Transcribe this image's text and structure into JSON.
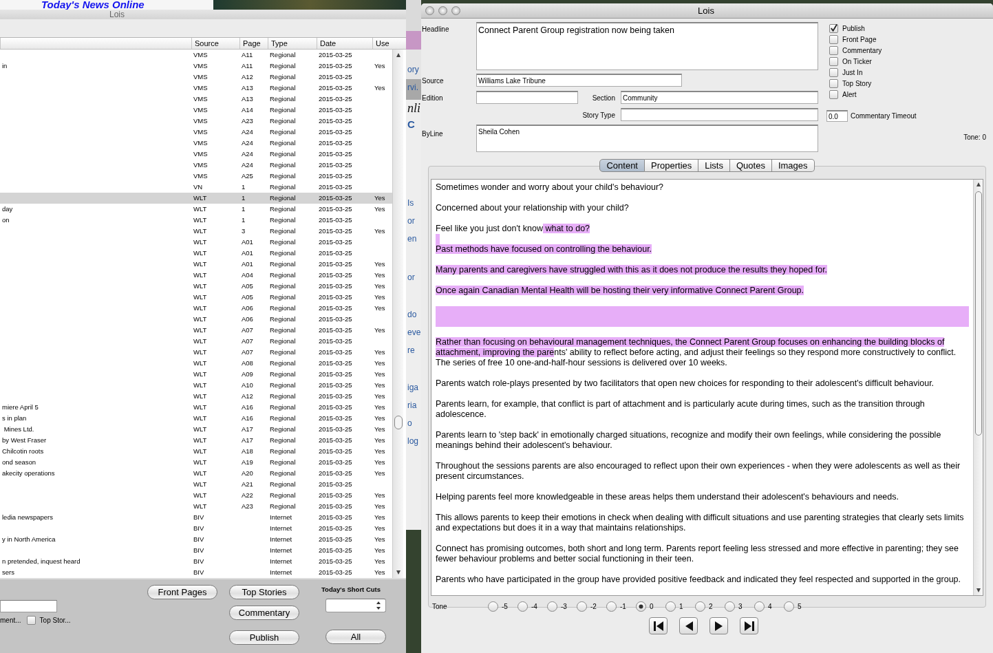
{
  "background": {
    "heading": "Today's News Online",
    "fragments": [
      "ory",
      "rvi.",
      "nli",
      "C",
      "Is",
      "or",
      "en",
      "or",
      "do",
      "eve",
      "re",
      "iga",
      "ria",
      "o",
      "log"
    ]
  },
  "list_window": {
    "title": "Lois",
    "columns": [
      "Source",
      "Page",
      "Type",
      "Date",
      "Use"
    ],
    "rows": [
      {
        "source": "VMS",
        "page": "A11",
        "type": "Regional",
        "date": "2015-03-25",
        "selected": false
      },
      {
        "title": "in",
        "source": "VMS",
        "page": "A11",
        "type": "Regional",
        "date": "2015-03-25",
        "use": "Yes",
        "selected": false
      },
      {
        "source": "VMS",
        "page": "A12",
        "type": "Regional",
        "date": "2015-03-25",
        "selected": false
      },
      {
        "source": "VMS",
        "page": "A13",
        "type": "Regional",
        "date": "2015-03-25",
        "use": "Yes",
        "selected": false
      },
      {
        "source": "VMS",
        "page": "A13",
        "type": "Regional",
        "date": "2015-03-25",
        "selected": false
      },
      {
        "source": "VMS",
        "page": "A14",
        "type": "Regional",
        "date": "2015-03-25",
        "selected": false
      },
      {
        "source": "VMS",
        "page": "A23",
        "type": "Regional",
        "date": "2015-03-25",
        "selected": false
      },
      {
        "source": "VMS",
        "page": "A24",
        "type": "Regional",
        "date": "2015-03-25",
        "selected": false
      },
      {
        "source": "VMS",
        "page": "A24",
        "type": "Regional",
        "date": "2015-03-25",
        "selected": false
      },
      {
        "source": "VMS",
        "page": "A24",
        "type": "Regional",
        "date": "2015-03-25",
        "selected": false
      },
      {
        "source": "VMS",
        "page": "A24",
        "type": "Regional",
        "date": "2015-03-25",
        "selected": false
      },
      {
        "source": "VMS",
        "page": "A25",
        "type": "Regional",
        "date": "2015-03-25",
        "selected": false
      },
      {
        "source": "VN",
        "page": "1",
        "type": "Regional",
        "date": "2015-03-25",
        "selected": false
      },
      {
        "source": "WLT",
        "page": "1",
        "type": "Regional",
        "date": "2015-03-25",
        "use": "Yes",
        "selected": true
      },
      {
        "title": "day",
        "source": "WLT",
        "page": "1",
        "type": "Regional",
        "date": "2015-03-25",
        "use": "Yes",
        "selected": false
      },
      {
        "title": "on",
        "source": "WLT",
        "page": "1",
        "type": "Regional",
        "date": "2015-03-25",
        "selected": false
      },
      {
        "source": "WLT",
        "page": "3",
        "type": "Regional",
        "date": "2015-03-25",
        "use": "Yes",
        "selected": false
      },
      {
        "source": "WLT",
        "page": "A01",
        "type": "Regional",
        "date": "2015-03-25",
        "selected": false
      },
      {
        "source": "WLT",
        "page": "A01",
        "type": "Regional",
        "date": "2015-03-25",
        "selected": false
      },
      {
        "source": "WLT",
        "page": "A01",
        "type": "Regional",
        "date": "2015-03-25",
        "use": "Yes",
        "selected": false
      },
      {
        "source": "WLT",
        "page": "A04",
        "type": "Regional",
        "date": "2015-03-25",
        "use": "Yes",
        "selected": false
      },
      {
        "source": "WLT",
        "page": "A05",
        "type": "Regional",
        "date": "2015-03-25",
        "use": "Yes",
        "selected": false
      },
      {
        "source": "WLT",
        "page": "A05",
        "type": "Regional",
        "date": "2015-03-25",
        "use": "Yes",
        "selected": false
      },
      {
        "source": "WLT",
        "page": "A06",
        "type": "Regional",
        "date": "2015-03-25",
        "use": "Yes",
        "selected": false
      },
      {
        "source": "WLT",
        "page": "A06",
        "type": "Regional",
        "date": "2015-03-25",
        "selected": false
      },
      {
        "source": "WLT",
        "page": "A07",
        "type": "Regional",
        "date": "2015-03-25",
        "use": "Yes",
        "selected": false
      },
      {
        "source": "WLT",
        "page": "A07",
        "type": "Regional",
        "date": "2015-03-25",
        "selected": false
      },
      {
        "source": "WLT",
        "page": "A07",
        "type": "Regional",
        "date": "2015-03-25",
        "use": "Yes",
        "selected": false
      },
      {
        "source": "WLT",
        "page": "A08",
        "type": "Regional",
        "date": "2015-03-25",
        "use": "Yes",
        "selected": false
      },
      {
        "source": "WLT",
        "page": "A09",
        "type": "Regional",
        "date": "2015-03-25",
        "use": "Yes",
        "selected": false
      },
      {
        "source": "WLT",
        "page": "A10",
        "type": "Regional",
        "date": "2015-03-25",
        "use": "Yes",
        "selected": false
      },
      {
        "source": "WLT",
        "page": "A12",
        "type": "Regional",
        "date": "2015-03-25",
        "use": "Yes",
        "selected": false
      },
      {
        "title": "miere April 5",
        "source": "WLT",
        "page": "A16",
        "type": "Regional",
        "date": "2015-03-25",
        "use": "Yes",
        "selected": false
      },
      {
        "title": "s in plan",
        "source": "WLT",
        "page": "A16",
        "type": "Regional",
        "date": "2015-03-25",
        "use": "Yes",
        "selected": false
      },
      {
        "title": " Mines Ltd.",
        "source": "WLT",
        "page": "A17",
        "type": "Regional",
        "date": "2015-03-25",
        "use": "Yes",
        "selected": false
      },
      {
        "title": "by West Fraser",
        "source": "WLT",
        "page": "A17",
        "type": "Regional",
        "date": "2015-03-25",
        "use": "Yes",
        "selected": false
      },
      {
        "title": "Chilcotin roots",
        "source": "WLT",
        "page": "A18",
        "type": "Regional",
        "date": "2015-03-25",
        "use": "Yes",
        "selected": false
      },
      {
        "title": "ond season",
        "source": "WLT",
        "page": "A19",
        "type": "Regional",
        "date": "2015-03-25",
        "use": "Yes",
        "selected": false
      },
      {
        "title": "akecity operations",
        "source": "WLT",
        "page": "A20",
        "type": "Regional",
        "date": "2015-03-25",
        "use": "Yes",
        "selected": false
      },
      {
        "source": "WLT",
        "page": "A21",
        "type": "Regional",
        "date": "2015-03-25",
        "selected": false
      },
      {
        "source": "WLT",
        "page": "A22",
        "type": "Regional",
        "date": "2015-03-25",
        "use": "Yes",
        "selected": false
      },
      {
        "source": "WLT",
        "page": "A23",
        "type": "Regional",
        "date": "2015-03-25",
        "use": "Yes",
        "selected": false
      },
      {
        "title": "ledia newspapers",
        "source": "BIV",
        "type": "Internet",
        "date": "2015-03-25",
        "use": "Yes",
        "selected": false
      },
      {
        "source": "BIV",
        "type": "Internet",
        "date": "2015-03-25",
        "use": "Yes",
        "selected": false
      },
      {
        "title": "y in North America",
        "source": "BIV",
        "type": "Internet",
        "date": "2015-03-25",
        "use": "Yes",
        "selected": false
      },
      {
        "source": "BIV",
        "type": "Internet",
        "date": "2015-03-25",
        "use": "Yes",
        "selected": false
      },
      {
        "title": "n pretended, inquest heard",
        "source": "BIV",
        "type": "Internet",
        "date": "2015-03-25",
        "use": "Yes",
        "selected": false
      },
      {
        "title": "sers",
        "source": "BIV",
        "type": "Internet",
        "date": "2015-03-25",
        "use": "Yes",
        "selected": false
      }
    ],
    "cut_label": "ment...",
    "top_story_check": {
      "label": "Top Stor...",
      "checked": false
    },
    "buttons_a": [
      "Front Pages"
    ],
    "buttons_b": [
      "Top Stories",
      "Commentary",
      "Publish"
    ],
    "short_cuts_label": "Today's Short Cuts",
    "all_button": "All"
  },
  "editor": {
    "title": "Lois",
    "headline": {
      "label": "Headline",
      "value": "Connect Parent Group registration now being taken"
    },
    "source": {
      "label": "Source",
      "value": "Williams Lake Tribune"
    },
    "edition": {
      "label": "Edition"
    },
    "section": {
      "label": "Section",
      "value": "Community"
    },
    "story_type": {
      "label": "Story Type"
    },
    "byline": {
      "label": "ByLine",
      "value": "Sheila Cohen"
    },
    "flags": [
      {
        "label": "Publish",
        "checked": true
      },
      {
        "label": "Front Page",
        "checked": false
      },
      {
        "label": "Commentary",
        "checked": false
      },
      {
        "label": "On Ticker",
        "checked": false
      },
      {
        "label": "Just In",
        "checked": false
      },
      {
        "label": "Top Story",
        "checked": false
      },
      {
        "label": "Alert",
        "checked": false
      }
    ],
    "commentary_timeout": {
      "label": "Commentary Timeout",
      "value": "0.0"
    },
    "tone_readout": "Tone: 0",
    "tabs": [
      {
        "label": "Content",
        "selected": true
      },
      {
        "label": "Properties",
        "selected": false
      },
      {
        "label": "Lists",
        "selected": false
      },
      {
        "label": "Quotes",
        "selected": false
      },
      {
        "label": "Images",
        "selected": false
      }
    ],
    "content": [
      {
        "kind": "text",
        "segments": [
          {
            "text": "Sometimes wonder and worry about your child's behaviour?",
            "highlighted": false
          }
        ]
      },
      {
        "kind": "text",
        "segments": [
          {
            "text": "Concerned about your relationship with your child?",
            "highlighted": false
          }
        ]
      },
      {
        "kind": "text",
        "segments": [
          {
            "text": "Feel like you just don't know",
            "highlighted": false
          },
          {
            "text": " what to do? ",
            "highlighted": true
          }
        ]
      },
      {
        "kind": "stub",
        "highlighted": true
      },
      {
        "kind": "text",
        "segments": [
          {
            "text": "Past methods have focused on controlling the behaviour. ",
            "highlighted": true
          }
        ]
      },
      {
        "kind": "text",
        "segments": [
          {
            "text": "Many parents and caregivers have struggled with this as it does not produce the results they hoped for. ",
            "highlighted": true
          }
        ]
      },
      {
        "kind": "text",
        "segments": [
          {
            "text": "Once again Canadian Mental Health will be hosting their very informative Connect Parent Group. ",
            "highlighted": true
          }
        ]
      },
      {
        "kind": "band",
        "highlighted": true
      },
      {
        "kind": "text",
        "segments": [
          {
            "text": "Rather than focusing on behavioural management techniques, the Connect Parent Group focuses on enhancing the building blocks of attachment, improving the pare",
            "highlighted": true
          },
          {
            "text": "nts' ability to reflect before acting, and adjust their feelings so they respond more constructively to conflict. The series of free 10 one-and-half-hour sessions is delivered over 10 weeks.",
            "highlighted": false
          }
        ]
      },
      {
        "kind": "text",
        "segments": [
          {
            "text": "Parents watch role-plays presented by two facilitators that open new choices for responding to their adolescent's difficult behaviour.",
            "highlighted": false
          }
        ]
      },
      {
        "kind": "text",
        "segments": [
          {
            "text": "Parents learn, for example, that conflict is part of attachment and is particularly acute during times, such as the transition through adolescence.",
            "highlighted": false
          }
        ]
      },
      {
        "kind": "text",
        "segments": [
          {
            "text": "Parents learn to 'step back' in emotionally charged situations, recognize and modify their own feelings, while considering the possible meanings behind their adolescent's behaviour.",
            "highlighted": false
          }
        ]
      },
      {
        "kind": "text",
        "segments": [
          {
            "text": "Throughout the sessions parents are also encouraged to reflect upon their own experiences - when they were adolescents as well as their present circumstances.",
            "highlighted": false
          }
        ]
      },
      {
        "kind": "text",
        "segments": [
          {
            "text": "Helping parents feel more knowledgeable in these areas helps them understand their adolescent's behaviours and needs.",
            "highlighted": false
          }
        ]
      },
      {
        "kind": "text",
        "segments": [
          {
            "text": "This allows parents to keep their emotions in check when dealing with difficult situations and use parenting strategies that clearly sets limits and expectations but does it in a way that maintains relationships.",
            "highlighted": false
          }
        ]
      },
      {
        "kind": "text",
        "segments": [
          {
            "text": "Connect has promising outcomes, both short and long term. Parents report feeling less stressed and more effective in parenting; they see fewer behaviour problems and better social functioning in their teen.",
            "highlighted": false
          }
        ]
      },
      {
        "kind": "text",
        "segments": [
          {
            "text": "Parents who have participated in the group have provided positive feedback and indicated they feel respected and supported in the group.",
            "highlighted": false
          }
        ]
      }
    ],
    "tone": {
      "label": "Tone",
      "options": [
        {
          "label": "-5",
          "selected": false
        },
        {
          "label": "-4",
          "selected": false
        },
        {
          "label": "-3",
          "selected": false
        },
        {
          "label": "-2",
          "selected": false
        },
        {
          "label": "-1",
          "selected": false
        },
        {
          "label": "0",
          "selected": true
        },
        {
          "label": "1",
          "selected": false
        },
        {
          "label": "2",
          "selected": false
        },
        {
          "label": "3",
          "selected": false
        },
        {
          "label": "4",
          "selected": false
        },
        {
          "label": "5",
          "selected": false
        }
      ]
    }
  }
}
